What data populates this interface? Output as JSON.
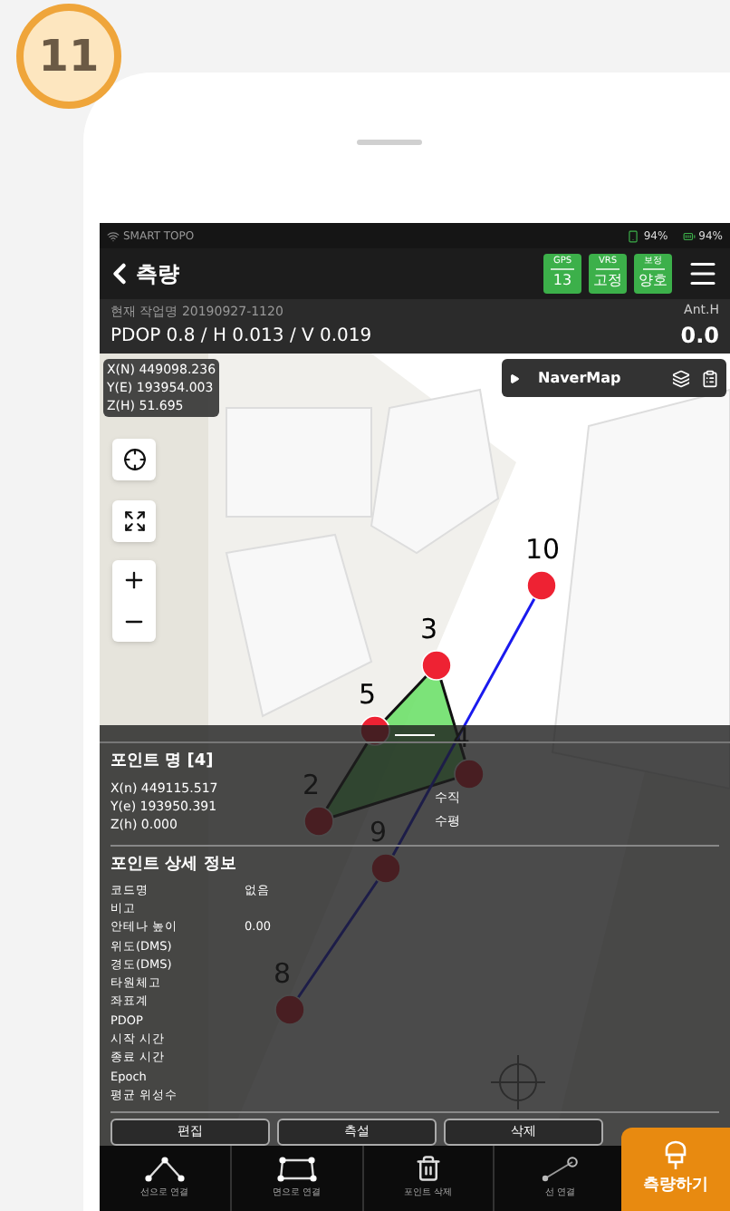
{
  "badge": "11",
  "status_bar": {
    "app": "SMART TOPO",
    "signal": "94%",
    "battery": "94%"
  },
  "header": {
    "title": "측량",
    "indicators": [
      {
        "label": "GPS",
        "value": "13"
      },
      {
        "label": "VRS",
        "value": "고정"
      },
      {
        "label": "보정",
        "value": "양호"
      }
    ]
  },
  "job": {
    "label": "현재 작업명 20190927-1120",
    "precision": "PDOP 0.8 / H 0.013 / V 0.019",
    "ant_label": "Ant.H",
    "ant_value": "0.0"
  },
  "map": {
    "coords": [
      "X(N) 449098.236",
      "Y(E) 193954.003",
      "Z(H) 51.695"
    ],
    "layer": "NaverMap",
    "points": [
      {
        "label": "10"
      },
      {
        "label": "3"
      },
      {
        "label": "5"
      },
      {
        "label": "4"
      },
      {
        "label": "2"
      },
      {
        "label": "9"
      },
      {
        "label": "8"
      }
    ]
  },
  "point": {
    "title": "포인트 명 [4]",
    "coords": [
      "X(n) 449115.517",
      "Y(e) 193950.391",
      "Z(h) 0.000"
    ],
    "modes": [
      "수직",
      "수평"
    ]
  },
  "details": {
    "title": "포인트 상세 정보",
    "rows": [
      {
        "name": "코드명",
        "value": "없음"
      },
      {
        "name": "비고"
      },
      {
        "name": "안테나 높이",
        "value": "0.00"
      },
      {
        "name": "위도(DMS)"
      },
      {
        "name": "경도(DMS)"
      },
      {
        "name": "타원체고"
      },
      {
        "name": "좌표계"
      },
      {
        "name": "PDOP"
      },
      {
        "name": "시작 시간"
      },
      {
        "name": "종료 시간"
      },
      {
        "name": "Epoch"
      },
      {
        "name": "평균 위성수"
      }
    ]
  },
  "actions": [
    "편집",
    "측설",
    "삭제"
  ],
  "toolbar": [
    {
      "kind": "line",
      "label": "선으로 연결"
    },
    {
      "kind": "polygon",
      "label": "면으로 연결"
    },
    {
      "kind": "delete",
      "label": "포인트 삭제"
    },
    {
      "kind": "connect",
      "label": "선 연결"
    }
  ],
  "measure_button": "측량하기"
}
